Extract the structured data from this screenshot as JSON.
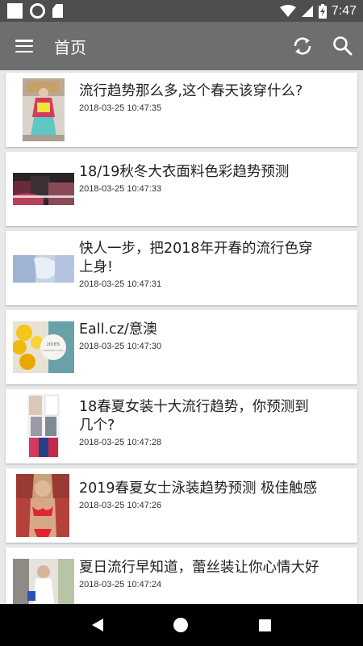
{
  "status_bar": {
    "time": "7:47"
  },
  "app_bar": {
    "title": "首页"
  },
  "items": [
    {
      "title": "流行趋势那么多,这个春天该穿什么?",
      "time": "2018-03-25 10:47:35"
    },
    {
      "title": "18/19秋冬大衣面料色彩趋势预测",
      "time": "2018-03-25 10:47:33"
    },
    {
      "title": "快人一步，把2018年开春的流行色穿上身!",
      "time": "2018-03-25 10:47:31"
    },
    {
      "title": "Eall.cz/意澳",
      "time": "2018-03-25 10:47:30"
    },
    {
      "title": "18春夏女装十大流行趋势，你预测到几个?",
      "time": "2018-03-25 10:47:28"
    },
    {
      "title": "2019春夏女士泳装趋势预测 极佳触感",
      "time": "2018-03-25 10:47:26"
    },
    {
      "title": "夏日流行早知道，蕾丝装让你心情大好",
      "time": "2018-03-25 10:47:24"
    }
  ],
  "thumbs": {
    "item_3_text": "2018'S Fashionable Colors"
  },
  "colors": {
    "status_bar": "#4e4e4e",
    "app_bar": "#6e6e6e",
    "background": "#e9e9e9",
    "nav_bar": "#000000"
  }
}
